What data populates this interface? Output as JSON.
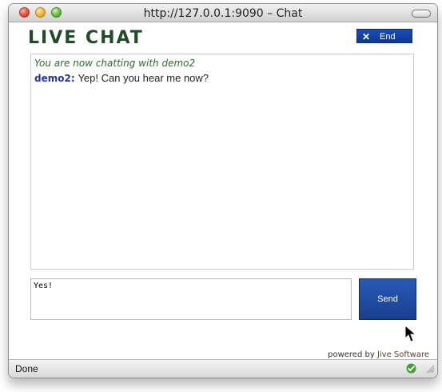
{
  "window": {
    "title": "http://127.0.0.1:9090 - Chat",
    "title_display": "http://127.0.0.1:9090 – Chat"
  },
  "header": {
    "title": "LIVE CHAT",
    "end_button_label": "End",
    "end_icon": "close-icon"
  },
  "transcript": {
    "system_message": "You are now chatting with demo2",
    "messages": [
      {
        "speaker": "demo2:",
        "text": "Yep! Can you hear me now?"
      }
    ]
  },
  "composer": {
    "input_value": "Yes!",
    "send_label": "Send"
  },
  "footer": {
    "powered_by_prefix": "powered by",
    "powered_by_brand": "Jive Software"
  },
  "status": {
    "text": "Done",
    "icon": "check-circle-icon"
  },
  "colors": {
    "title_green": "#234B27",
    "accent_blue": "#173F8D",
    "speaker_blue": "#2235A8",
    "system_green": "#2E6A2D",
    "status_green": "#3FA030"
  }
}
